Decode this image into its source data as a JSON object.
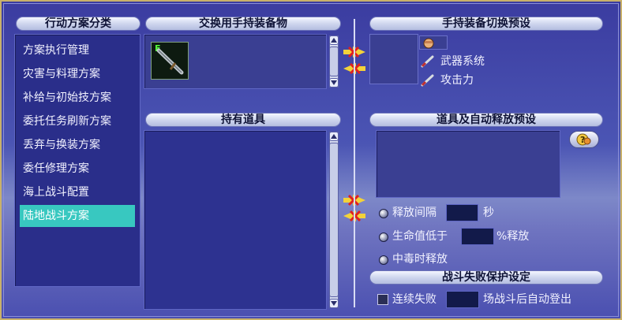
{
  "left_panel": {
    "title": "行动方案分类",
    "items": [
      {
        "label": "方案执行管理",
        "selected": false
      },
      {
        "label": "灾害与料理方案",
        "selected": false
      },
      {
        "label": "补给与初始技方案",
        "selected": false
      },
      {
        "label": "委托任务刷新方案",
        "selected": false
      },
      {
        "label": "丢弃与换装方案",
        "selected": false
      },
      {
        "label": "委任修理方案",
        "selected": false
      },
      {
        "label": "海上战斗配置",
        "selected": false
      },
      {
        "label": "陆地战斗方案",
        "selected": true
      }
    ]
  },
  "middle": {
    "exchange_title": "交换用手持装备物",
    "held_items_title": "持有道具",
    "weapon_icon": "sword-icon",
    "weapon_badge": "E"
  },
  "right": {
    "preset_title": "手持装备切换预设",
    "preset_rows": [
      {
        "icon": "fist-icon",
        "label": ""
      },
      {
        "icon": "sword-small-icon",
        "label": "武器系统"
      },
      {
        "icon": "sword-small-icon",
        "label": "攻击力"
      }
    ],
    "auto_release_title": "道具及自动释放预设",
    "help_icon": "help-icon",
    "release_interval_label": "释放间隔",
    "release_interval_value": "",
    "release_interval_unit": "秒",
    "hp_below_label": "生命值低于",
    "hp_below_value": "",
    "hp_below_suffix": "%释放",
    "poison_label": "中毒时释放",
    "defeat_title": "战斗失败保护设定",
    "consecutive_loss_label": "连续失败",
    "consecutive_loss_value": "",
    "consecutive_loss_suffix": "场战斗后自动登出"
  },
  "colors": {
    "selected_item": "#38c8c0",
    "window_border": "#c9b16a",
    "arrow_yellow": "#f3d23a",
    "cross_red": "#e02020"
  }
}
